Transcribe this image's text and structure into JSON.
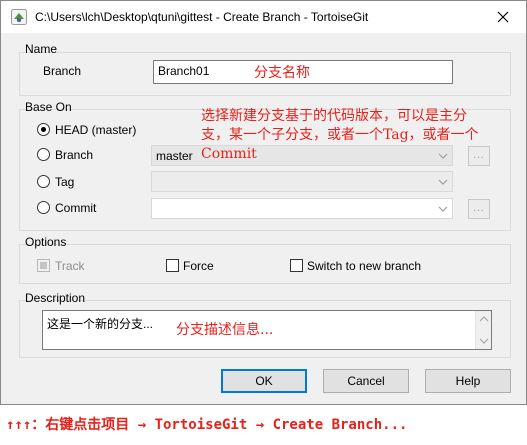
{
  "window": {
    "title": "C:\\Users\\lch\\Desktop\\qtuni\\gittest - Create Branch - TortoiseGit"
  },
  "name_group": {
    "label": "Name",
    "branch_label": "Branch",
    "branch_value": "Branch01",
    "annotation": "分支名称"
  },
  "base_on_group": {
    "label": "Base On",
    "head_label": "HEAD (master)",
    "branch_label": "Branch",
    "branch_combo_value": "master",
    "tag_label": "Tag",
    "commit_label": "Commit",
    "annotation_lines": [
      "选择新建分支基于的代码版本，可以是主分",
      "支，某一个子分支，或者一个Tag，或者一个",
      "Commit"
    ]
  },
  "options_group": {
    "label": "Options",
    "track_label": "Track",
    "force_label": "Force",
    "switch_label": "Switch to new branch"
  },
  "description_group": {
    "label": "Description",
    "text": "这是一个新的分支...",
    "annotation": "分支描述信息..."
  },
  "buttons": {
    "ok": "OK",
    "cancel": "Cancel",
    "help": "Help"
  },
  "footer_note": "↑↑↑：右键点击项目 → TortoiseGit → Create Branch...",
  "colors": {
    "annotation": "#e8201a",
    "default_button_border": "#0078d7"
  }
}
